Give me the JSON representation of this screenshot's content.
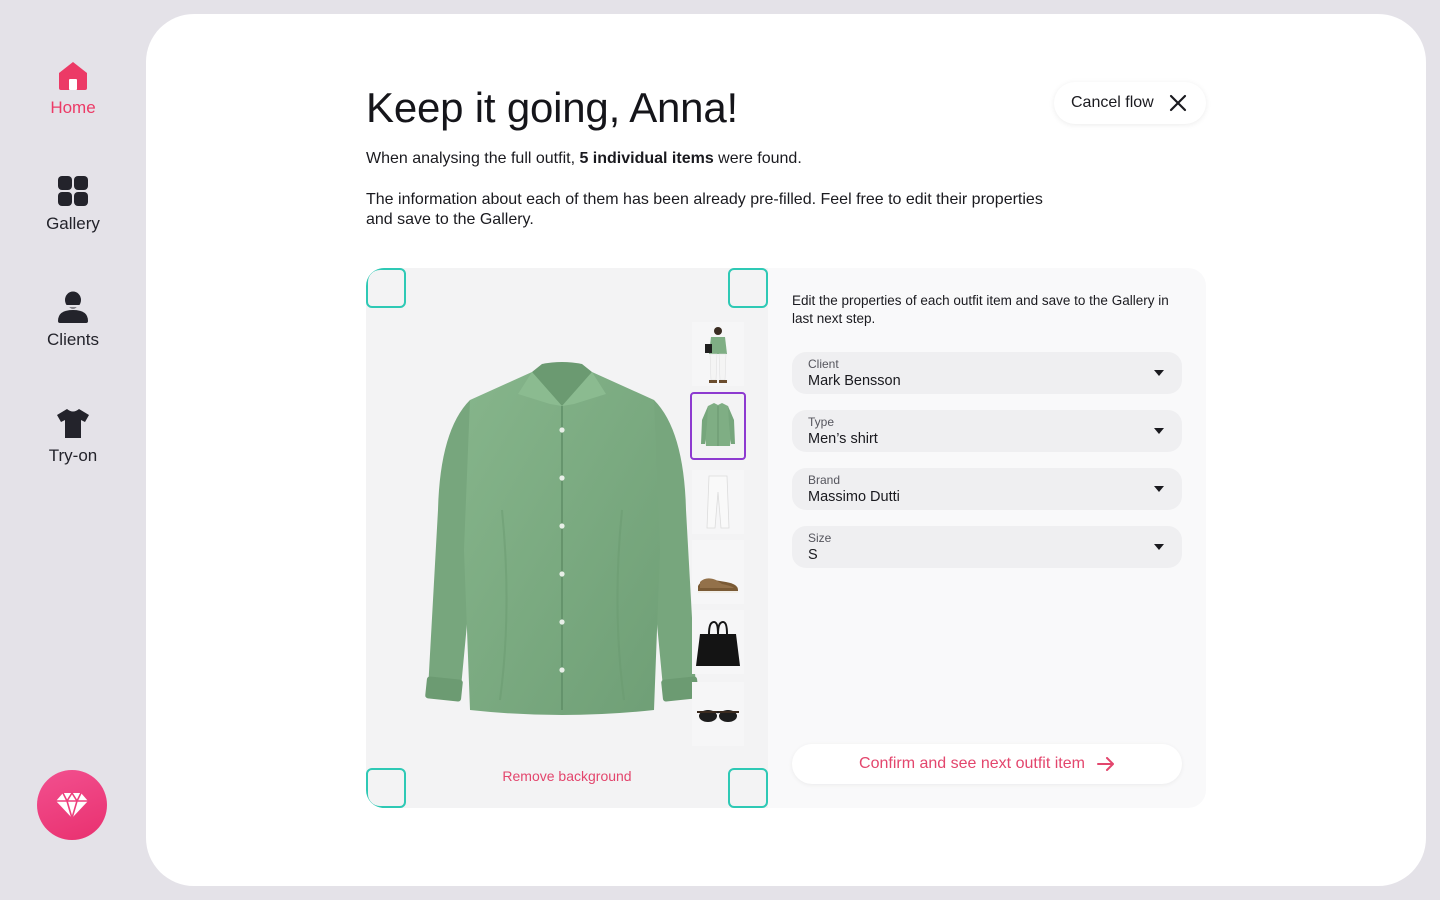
{
  "nav": {
    "items": [
      {
        "label": "Home",
        "icon": "home-icon",
        "active": true
      },
      {
        "label": "Gallery",
        "icon": "grid-icon",
        "active": false
      },
      {
        "label": "Clients",
        "icon": "person-icon",
        "active": false
      },
      {
        "label": "Try-on",
        "icon": "tshirt-icon",
        "active": false
      }
    ],
    "premium_icon": "diamond-icon"
  },
  "header": {
    "title": "Keep it going, Anna!",
    "cancel_label": "Cancel flow"
  },
  "intro": {
    "line_prefix": "When analysing the full outfit, ",
    "line_bold": "5 individual items",
    "line_suffix": " were found.",
    "paragraph": "The information about each of them has been already pre-filled. Feel free to edit their properties and save to the Gallery."
  },
  "image_panel": {
    "remove_background_label": "Remove background",
    "thumbnails": [
      "full-outfit",
      "green-shirt",
      "white-trousers",
      "brown-shoes",
      "black-bag",
      "sunglasses"
    ],
    "selected_thumbnail": "green-shirt"
  },
  "form": {
    "description": "Edit the properties of each outfit item and save to the Gallery in last next step.",
    "fields": [
      {
        "label": "Client",
        "value": "Mark Bensson"
      },
      {
        "label": "Type",
        "value": "Men’s shirt"
      },
      {
        "label": "Brand",
        "value": "Massimo Dutti"
      },
      {
        "label": "Size",
        "value": "S"
      }
    ],
    "confirm_label": "Confirm and see next outfit item"
  },
  "colors": {
    "accent": "#e3466d",
    "selection": "#8d3ad0",
    "crop_corner": "#2ec9b5",
    "shirt": "#7fae84"
  }
}
